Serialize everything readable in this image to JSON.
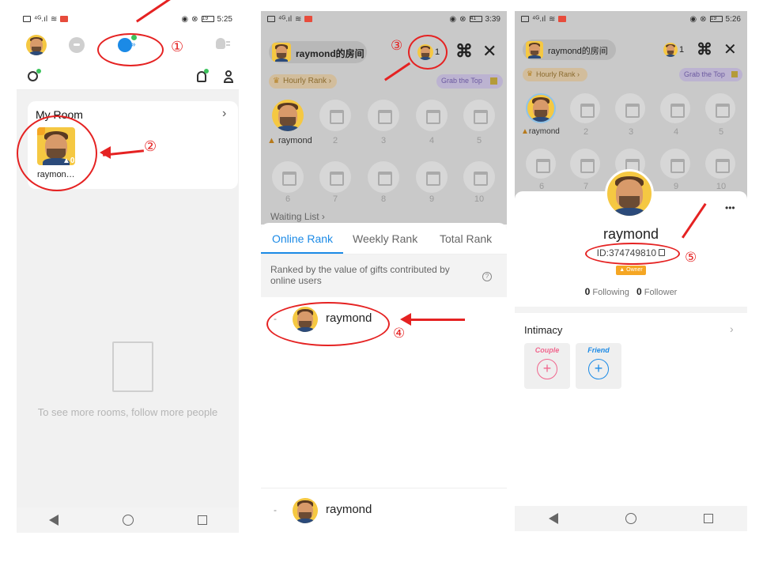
{
  "screens": [
    {
      "status": {
        "time": "5:25",
        "battery": "19"
      },
      "my_room": {
        "title": "My Room",
        "chevron": "›",
        "room_owner": "raymon…",
        "listener_count": "0"
      },
      "empty_message": "To see more rooms, follow more people",
      "annotations": {
        "tab": "①",
        "room": "②"
      }
    },
    {
      "status": {
        "time": "3:39",
        "battery": "41"
      },
      "room_title": "raymond的房间",
      "online_count": "1",
      "hourly_rank": "Hourly Rank ›",
      "grab_top": "Grab the Top",
      "host_name": "raymond",
      "seat_numbers": [
        "2",
        "3",
        "4",
        "5",
        "6",
        "7",
        "8",
        "9",
        "10"
      ],
      "waiting_list": "Waiting List ›",
      "tabs": [
        "Online Rank",
        "Weekly Rank",
        "Total Rank"
      ],
      "rank_description": "Ranked by the value of gifts contributed by online users",
      "rank_item": {
        "rank": "-",
        "name": "raymond"
      },
      "my_rank": {
        "rank": "-",
        "name": "raymond"
      },
      "annotations": {
        "avatar": "③",
        "rank": "④"
      }
    },
    {
      "status": {
        "time": "5:26",
        "battery": "19"
      },
      "room_title": "raymond的房间",
      "online_count": "1",
      "hourly_rank": "Hourly Rank ›",
      "grab_top": "Grab the Top",
      "host_name": "raymond",
      "seat_numbers": [
        "2",
        "3",
        "4",
        "5",
        "6",
        "7",
        "8",
        "9",
        "10"
      ],
      "profile": {
        "name": "raymond",
        "id": "ID:374749810",
        "role": "Owner",
        "following_count": "0",
        "following_label": "Following",
        "follower_count": "0",
        "follower_label": "Follower",
        "intimacy_title": "Intimacy",
        "couple_label": "Couple",
        "friend_label": "Friend",
        "more": "•••"
      },
      "annotations": {
        "id": "⑤"
      }
    }
  ],
  "colors": {
    "accent_blue": "#1b8ae6",
    "annotation_red": "#e52222",
    "owner_orange": "#f5a623",
    "couple_pink": "#f0678e"
  }
}
